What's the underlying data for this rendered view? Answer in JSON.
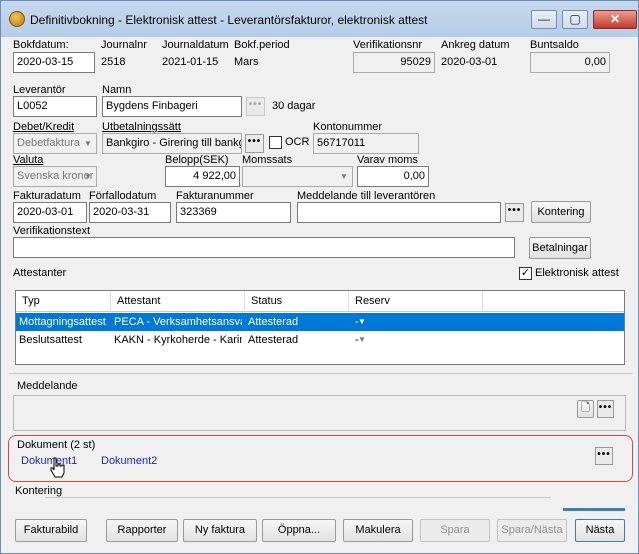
{
  "window": {
    "title": "Definitivbokning - Elektronisk attest - Leverantörsfakturor, elektronisk attest",
    "minimize": "—",
    "maximize": "▢",
    "close": "✕"
  },
  "header": {
    "bokfdatum_label": "Bokfdatum:",
    "bokfdatum": "2020-03-15",
    "journalnr_label": "Journalnr",
    "journalnr": "2518",
    "journaldatum_label": "Journaldatum",
    "journaldatum": "2021-01-15",
    "bokfperiod_label": "Bokf.period",
    "bokfperiod": "Mars",
    "verifikationsnr_label": "Verifikationsnr",
    "verifikationsnr": "95029",
    "ankreg_label": "Ankreg datum",
    "ankreg": "2020-03-01",
    "buntsaldo_label": "Buntsaldo",
    "buntsaldo": "0,00"
  },
  "supplier": {
    "leverantor_label": "Leverantör",
    "leverantor": "L0052",
    "namn_label": "Namn",
    "namn": "Bygdens Finbageri",
    "terms": "30 dagar",
    "debetkredit_label": "Debet/Kredit",
    "debetkredit": "Debetfaktura",
    "utbetalningssatt_label": "Utbetalningssätt",
    "utbetalningssatt": "Bankgiro - Girering till bankgiro",
    "ocr_label": "OCR",
    "kontonummer_label": "Kontonummer",
    "kontonummer": "56717011",
    "valuta_label": "Valuta",
    "valuta": "Svenska kronor",
    "belopp_label": "Belopp(SEK)",
    "belopp": "4 922,00",
    "momssats_label": "Momssats",
    "momssats": "",
    "varavmoms_label": "Varav moms",
    "varavmoms": "0,00",
    "fakturadatum_label": "Fakturadatum",
    "fakturadatum": "2020-03-01",
    "forfallodatum_label": "Förfallodatum",
    "forfallodatum": "2020-03-31",
    "fakturanummer_label": "Fakturanummer",
    "fakturanummer": "323369",
    "meddelande_lev_label": "Meddelande till leverantören",
    "meddelande_lev": "",
    "kontering_button": "Kontering",
    "verifikationstext_label": "Verifikationstext",
    "verifikationstext": "",
    "betalningar_button": "Betalningar"
  },
  "attest": {
    "section_label": "Attestanter",
    "elektronisk_label": "Elektronisk attest",
    "elektronisk_checked": "✓",
    "columns": [
      "Typ",
      "Attestant",
      "Status",
      "Reserv"
    ],
    "rows": [
      {
        "typ": "Mottagningsattest",
        "attestant": "PECA - Verksamhetsansvarig",
        "status": "Attesterad",
        "reserv": "-"
      },
      {
        "typ": "Beslutsattest",
        "attestant": "KAKN - Kyrkoherde - Karin",
        "status": "Attesterad",
        "reserv": "-"
      }
    ]
  },
  "meddelande": {
    "label": "Meddelande"
  },
  "dokument": {
    "label": "Dokument (2 st)",
    "items": [
      "Dokument1",
      "Dokument2"
    ]
  },
  "kontering": {
    "label": "Kontering"
  },
  "footer": {
    "fakturabild": "Fakturabild",
    "rapporter": "Rapporter",
    "ny_faktura": "Ny faktura",
    "oppna": "Öppna...",
    "makulera": "Makulera",
    "spara": "Spara",
    "spara_nasta": "Spara/Nästa",
    "nasta": "Nästa"
  },
  "ellipsis": "•••",
  "colors": {
    "selection": "#0078d7",
    "link": "#1a2ab8",
    "highlight_frame": "#d64848"
  }
}
